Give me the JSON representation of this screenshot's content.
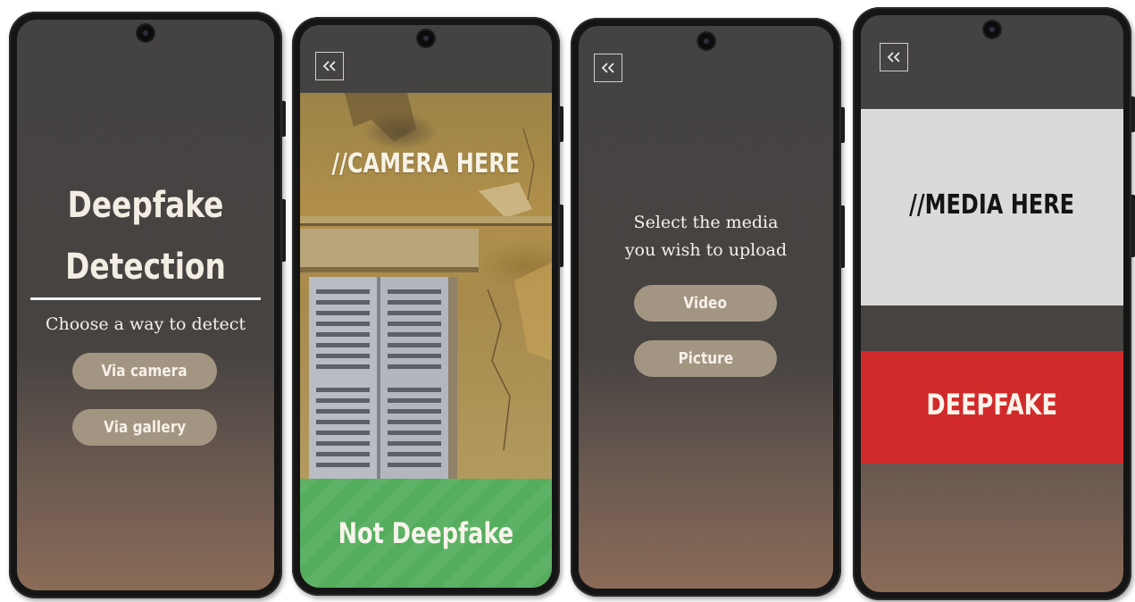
{
  "screen1": {
    "title_line1": "Deepfake",
    "title_line2": "Detection",
    "subtitle": "Choose a way to detect",
    "btn_camera": "Via camera",
    "btn_gallery": "Via gallery"
  },
  "screen2": {
    "camera_placeholder": "//CAMERA HERE",
    "result_label": "Not Deepfake",
    "result_color": "#54ad5c"
  },
  "screen3": {
    "prompt_line1": "Select the media",
    "prompt_line2": "you wish to upload",
    "btn_video": "Video",
    "btn_picture": "Picture"
  },
  "screen4": {
    "media_placeholder": "//MEDIA HERE",
    "result_label": "DEEPFAKE",
    "result_color": "#d12a2a"
  },
  "colors": {
    "background_top": "#454342",
    "background_bottom": "#8a6b57",
    "pill": "#a29582",
    "text_light": "#f3ede3"
  },
  "icons": {
    "back": "double-chevron-left-icon",
    "camera": "front-camera-icon"
  }
}
